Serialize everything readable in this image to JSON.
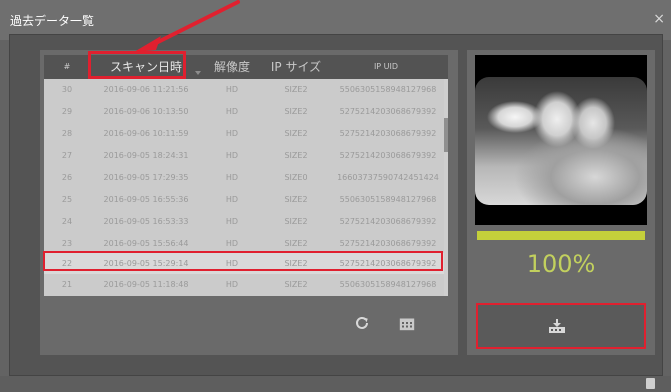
{
  "window": {
    "title": "過去データ一覧",
    "close_glyph": "×"
  },
  "table": {
    "headers": {
      "index": "#",
      "scan_datetime": "スキャン日時",
      "resolution": "解像度",
      "ip_size": "IP サイズ",
      "ip_uid": "IP UID"
    },
    "rows": [
      {
        "index": "30",
        "datetime": "2016-09-06 11:21:56",
        "resolution": "HD",
        "ip_size": "SIZE2",
        "ip_uid": "5506305158948127968"
      },
      {
        "index": "29",
        "datetime": "2016-09-06 10:13:50",
        "resolution": "HD",
        "ip_size": "SIZE2",
        "ip_uid": "5275214203068679392"
      },
      {
        "index": "28",
        "datetime": "2016-09-06 10:11:59",
        "resolution": "HD",
        "ip_size": "SIZE2",
        "ip_uid": "5275214203068679392"
      },
      {
        "index": "27",
        "datetime": "2016-09-05 18:24:31",
        "resolution": "HD",
        "ip_size": "SIZE2",
        "ip_uid": "5275214203068679392"
      },
      {
        "index": "26",
        "datetime": "2016-09-05 17:29:35",
        "resolution": "HD",
        "ip_size": "SIZE0",
        "ip_uid": "16603737590742451424"
      },
      {
        "index": "25",
        "datetime": "2016-09-05 16:55:36",
        "resolution": "HD",
        "ip_size": "SIZE2",
        "ip_uid": "5506305158948127968"
      },
      {
        "index": "24",
        "datetime": "2016-09-05 16:53:33",
        "resolution": "HD",
        "ip_size": "SIZE2",
        "ip_uid": "5275214203068679392"
      },
      {
        "index": "23",
        "datetime": "2016-09-05 15:56:44",
        "resolution": "HD",
        "ip_size": "SIZE2",
        "ip_uid": "5275214203068679392"
      },
      {
        "index": "22",
        "datetime": "2016-09-05 15:29:14",
        "resolution": "HD",
        "ip_size": "SIZE2",
        "ip_uid": "5275214203068679392"
      },
      {
        "index": "21",
        "datetime": "2016-09-05 11:18:48",
        "resolution": "HD",
        "ip_size": "SIZE2",
        "ip_uid": "5506305158948127968"
      }
    ],
    "selected_row_index": "22"
  },
  "preview": {
    "progress_percent_text": "100%",
    "progress_value": 1.0
  },
  "icons": {
    "refresh": "refresh-icon",
    "calendar": "calendar-icon",
    "download": "download-icon",
    "close": "close-icon",
    "footer": "footer-icon"
  },
  "colors": {
    "highlight": "#e0202f",
    "progress": "#c4d03b",
    "percent_text": "#c2d05e"
  }
}
